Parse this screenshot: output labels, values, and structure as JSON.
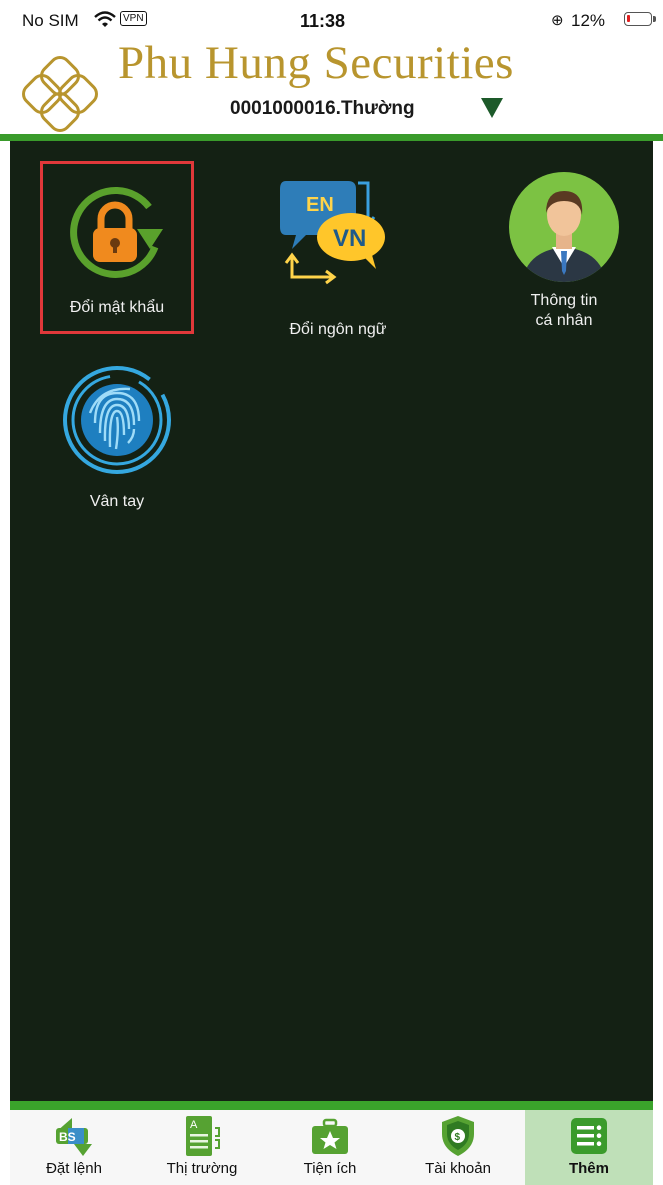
{
  "status": {
    "carrier": "No SIM",
    "vpn": "VPN",
    "time": "11:38",
    "battery_text": "12%",
    "battery_level": 0.12
  },
  "header": {
    "brand": "Phu Hung Securities",
    "account": "0001000016.Thường"
  },
  "tiles": [
    {
      "label": "Đổi mật khẩu",
      "icon": "lock-refresh-icon",
      "highlighted": true
    },
    {
      "label": "Đổi ngôn ngữ",
      "icon": "language-en-vn-icon",
      "icon_text_1": "EN",
      "icon_text_2": "VN"
    },
    {
      "label_line1": "Thông tin",
      "label_line2": "cá nhân",
      "icon": "user-avatar-icon"
    },
    {
      "label": "Vân tay",
      "icon": "fingerprint-icon"
    }
  ],
  "tabs": [
    {
      "label": "Đặt lệnh",
      "icon": "order-bs-icon",
      "icon_text": "BS"
    },
    {
      "label": "Thị trường",
      "icon": "market-book-icon",
      "icon_text": "A"
    },
    {
      "label": "Tiện ích",
      "icon": "utility-star-icon"
    },
    {
      "label": "Tài khoản",
      "icon": "account-shield-icon"
    },
    {
      "label": "Thêm",
      "icon": "more-menu-icon",
      "active": true
    }
  ],
  "colors": {
    "brand_gold": "#b8952e",
    "accent_green": "#3a9b2b",
    "background_dark": "#142114",
    "highlight_red": "#e0383a",
    "active_tab": "#bfe0b8"
  }
}
